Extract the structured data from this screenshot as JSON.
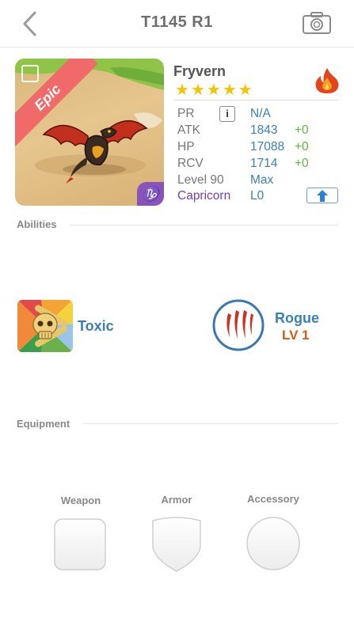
{
  "header": {
    "title": "T1145 R1"
  },
  "card": {
    "rarity": "Epic",
    "sign_glyph": "♑"
  },
  "monster": {
    "name": "Fryvern",
    "stars": [
      "★",
      "★",
      "★",
      "★",
      "★"
    ],
    "element": "fire"
  },
  "stats": {
    "pr": {
      "label": "PR",
      "info": "i",
      "value": "N/A"
    },
    "atk": {
      "label": "ATK",
      "value": "1843",
      "bonus": "+0"
    },
    "hp": {
      "label": "HP",
      "value": "17088",
      "bonus": "+0"
    },
    "rcv": {
      "label": "RCV",
      "value": "1714",
      "bonus": "+0"
    },
    "level": {
      "label": "Level 90",
      "value": "Max"
    },
    "sign": {
      "label": "Capricorn",
      "value": "L0"
    }
  },
  "abilities": {
    "title": "Abilities",
    "ability": {
      "name": "Toxic",
      "icon": "skull-icon"
    },
    "class": {
      "name": "Rogue",
      "level": "LV 1",
      "icon": "claw-icon"
    }
  },
  "equipment": {
    "title": "Equipment",
    "slots": [
      {
        "label": "Weapon",
        "shape": "rounded-square"
      },
      {
        "label": "Armor",
        "shape": "shield"
      },
      {
        "label": "Accessory",
        "shape": "circle"
      }
    ]
  },
  "colors": {
    "accent_blue": "#3b7fb5",
    "bonus_green": "#5cb83a",
    "rarity_red": "#f06a6a",
    "sign_purple": "#7a3ea8",
    "class_level_orange": "#d35c1a"
  }
}
